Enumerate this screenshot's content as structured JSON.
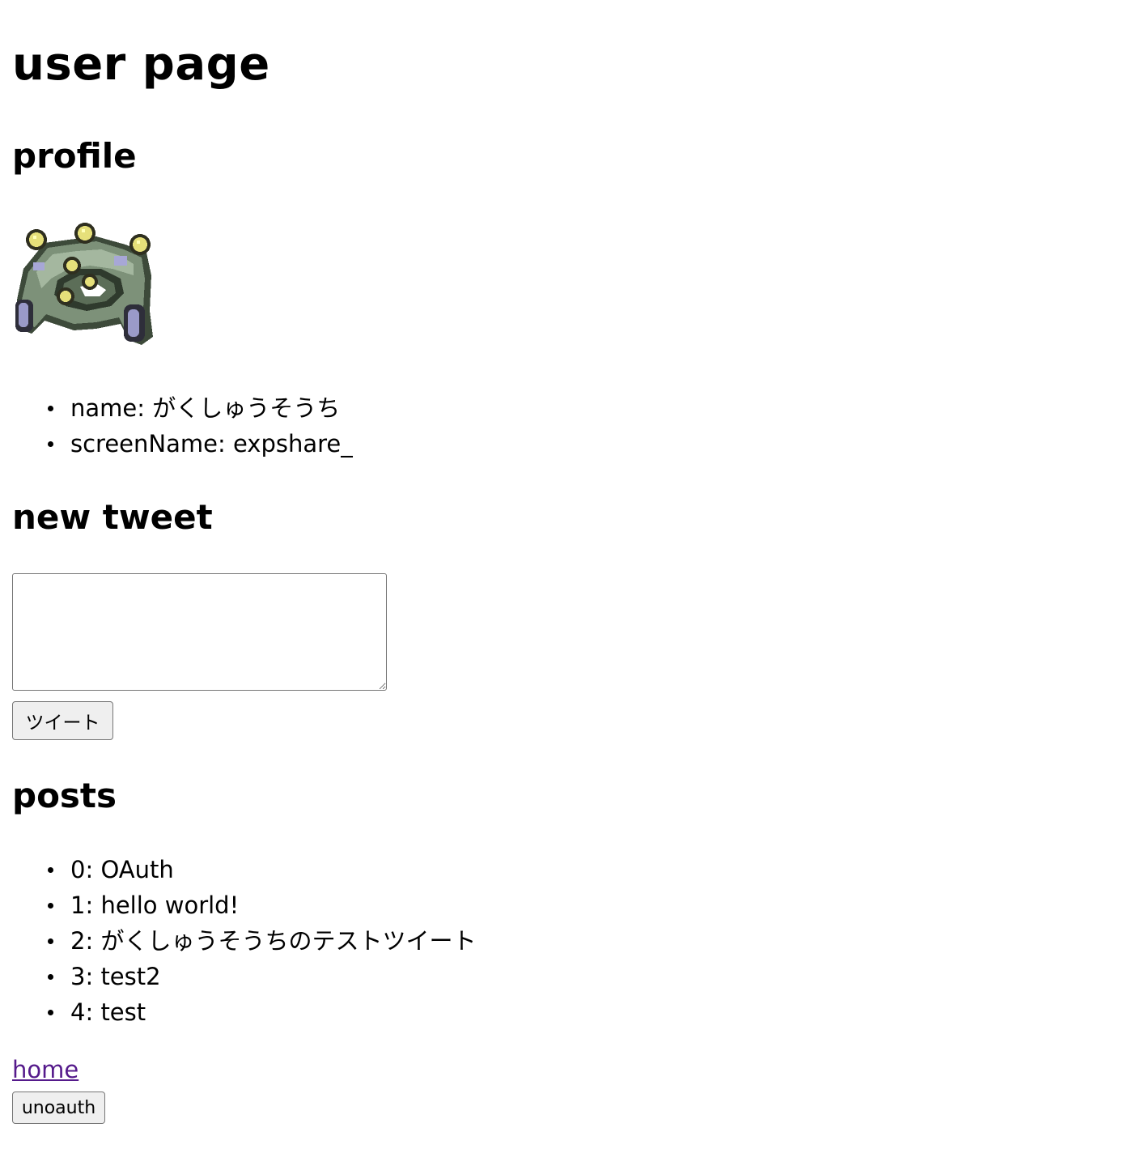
{
  "page": {
    "title": "user page"
  },
  "profile": {
    "heading": "profile",
    "avatar_icon": "pixel-sprite-avatar",
    "items": [
      {
        "text": "name: がくしゅうそうち"
      },
      {
        "text": "screenName: expshare_"
      }
    ]
  },
  "new_tweet": {
    "heading": "new tweet",
    "textarea_value": "",
    "submit_label": "ツイート"
  },
  "posts": {
    "heading": "posts",
    "items": [
      {
        "text": "0: OAuth"
      },
      {
        "text": "1: hello world!"
      },
      {
        "text": "2: がくしゅうそうちのテストツイート"
      },
      {
        "text": "3: test2"
      },
      {
        "text": "4: test"
      }
    ]
  },
  "footer": {
    "home_link": "home",
    "unoauth_label": "unoauth"
  },
  "colors": {
    "link_visited": "#551a8b",
    "button_bg": "#efefef",
    "button_border": "#767676"
  }
}
